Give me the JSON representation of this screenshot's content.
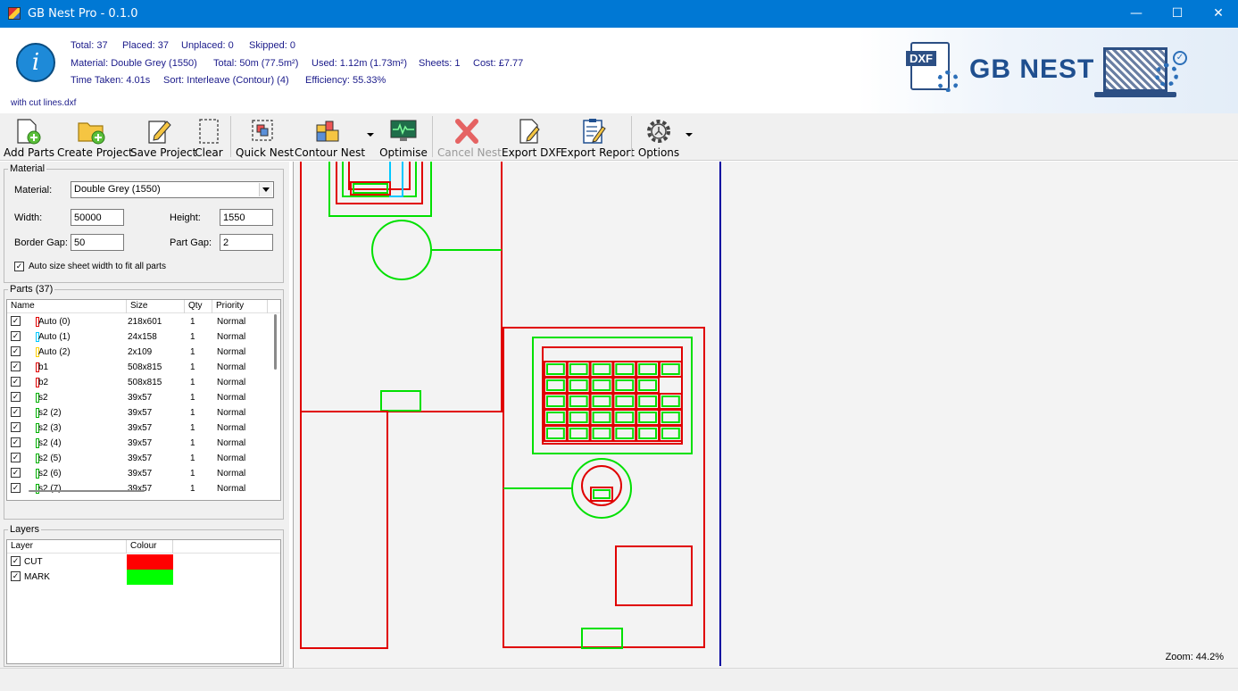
{
  "window": {
    "title": "GB Nest Pro - 0.1.0",
    "minimize": "—",
    "maximize": "☐",
    "close": "✕"
  },
  "summary": {
    "total": "Total: 37",
    "placed": "Placed: 37",
    "unplaced": "Unplaced: 0",
    "skipped": "Skipped: 0",
    "material": "Material: Double Grey (1550)",
    "total_length": "Total: 50m (77.5m²)",
    "used": "Used: 1.12m (1.73m²)",
    "sheets": "Sheets: 1",
    "cost": "Cost: £7.77",
    "time_taken": "Time Taken: 4.01s",
    "sort": "Sort: Interleave (Contour) (4)",
    "efficiency": "Efficiency: 55.33%",
    "filename": "with cut lines.dxf"
  },
  "logo": {
    "dxf": "DXF",
    "brand": "GB NEST"
  },
  "toolbar": {
    "add_parts": "Add Parts",
    "create_project": "Create Project",
    "save_project": "Save Project",
    "clear": "Clear",
    "quick_nest": "Quick Nest",
    "contour_nest": "Contour Nest",
    "optimise": "Optimise",
    "cancel_nest": "Cancel Nest",
    "export_dxf": "Export DXF",
    "export_report": "Export Report",
    "options": "Options"
  },
  "material_panel": {
    "legend": "Material",
    "material_label": "Material:",
    "material_value": "Double Grey (1550)",
    "width_label": "Width:",
    "width_value": "50000",
    "height_label": "Height:",
    "height_value": "1550",
    "border_gap_label": "Border Gap:",
    "border_gap_value": "50",
    "part_gap_label": "Part Gap:",
    "part_gap_value": "2",
    "autosize_label": "Auto size sheet width to fit all parts"
  },
  "parts_panel": {
    "legend": "Parts (37)",
    "columns": [
      "Name",
      "Size",
      "Qty",
      "Priority"
    ],
    "rows": [
      {
        "name": "Auto (0)",
        "size": "218x601",
        "qty": "1",
        "priority": "Normal",
        "color": "#e00000"
      },
      {
        "name": "Auto (1)",
        "size": "24x158",
        "qty": "1",
        "priority": "Normal",
        "color": "#00c8ff"
      },
      {
        "name": "Auto (2)",
        "size": "2x109",
        "qty": "1",
        "priority": "Normal",
        "color": "#ffd000"
      },
      {
        "name": "b1",
        "size": "508x815",
        "qty": "1",
        "priority": "Normal",
        "color": "#e00000"
      },
      {
        "name": "b2",
        "size": "508x815",
        "qty": "1",
        "priority": "Normal",
        "color": "#e00000"
      },
      {
        "name": "s2",
        "size": "39x57",
        "qty": "1",
        "priority": "Normal",
        "color": "#00b000"
      },
      {
        "name": "s2 (2)",
        "size": "39x57",
        "qty": "1",
        "priority": "Normal",
        "color": "#00b000"
      },
      {
        "name": "s2 (3)",
        "size": "39x57",
        "qty": "1",
        "priority": "Normal",
        "color": "#00b000"
      },
      {
        "name": "s2 (4)",
        "size": "39x57",
        "qty": "1",
        "priority": "Normal",
        "color": "#00b000"
      },
      {
        "name": "s2 (5)",
        "size": "39x57",
        "qty": "1",
        "priority": "Normal",
        "color": "#00b000"
      },
      {
        "name": "s2 (6)",
        "size": "39x57",
        "qty": "1",
        "priority": "Normal",
        "color": "#00b000"
      },
      {
        "name": "s2 (7)",
        "size": "39x57",
        "qty": "1",
        "priority": "Normal",
        "color": "#00b000"
      }
    ]
  },
  "layers_panel": {
    "legend": "Layers",
    "columns": [
      "Layer",
      "Colour"
    ],
    "rows": [
      {
        "name": "CUT",
        "color": "#ff0000"
      },
      {
        "name": "MARK",
        "color": "#00ff00"
      }
    ]
  },
  "canvas": {
    "zoom": "Zoom: 44.2%",
    "cut_color": "#e00000",
    "mark_color": "#00e000",
    "sheet_edge_color": "#0000a0"
  }
}
